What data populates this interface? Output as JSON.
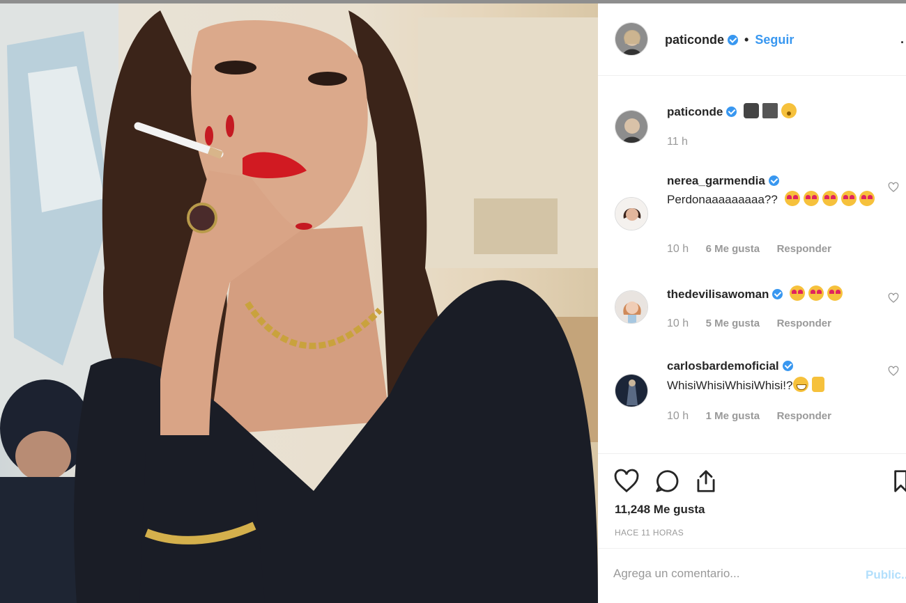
{
  "post": {
    "username": "paticonde",
    "follow_label": "Seguir",
    "separator": "•",
    "more_label": "·",
    "caption_time": "11 h"
  },
  "comments": [
    {
      "username": "nerea_garmendia",
      "text": "Perdonaaaaaaaaa??",
      "time": "10 h",
      "likes": "6 Me gusta",
      "reply": "Responder"
    },
    {
      "username": "thedevilisawoman",
      "text": "",
      "time": "10 h",
      "likes": "5 Me gusta",
      "reply": "Responder"
    },
    {
      "username": "carlosbardemoficial",
      "text": "WhisiWhisiWhisiWhisi!?",
      "time": "10 h",
      "likes": "1 Me gusta",
      "reply": "Responder"
    }
  ],
  "actions": {
    "likes_total": "11,248 Me gusta",
    "time_ago": "HACE 11 HORAS"
  },
  "comment_box": {
    "placeholder": "Agrega un comentario...",
    "publish_label": "Public..."
  },
  "icons": [
    "heart-icon",
    "comment-icon",
    "share-icon",
    "bookmark-icon",
    "verified-icon",
    "more-icon"
  ],
  "colors": {
    "link_blue": "#3897f0",
    "verified_blue": "#3897f0",
    "muted": "#999999"
  }
}
